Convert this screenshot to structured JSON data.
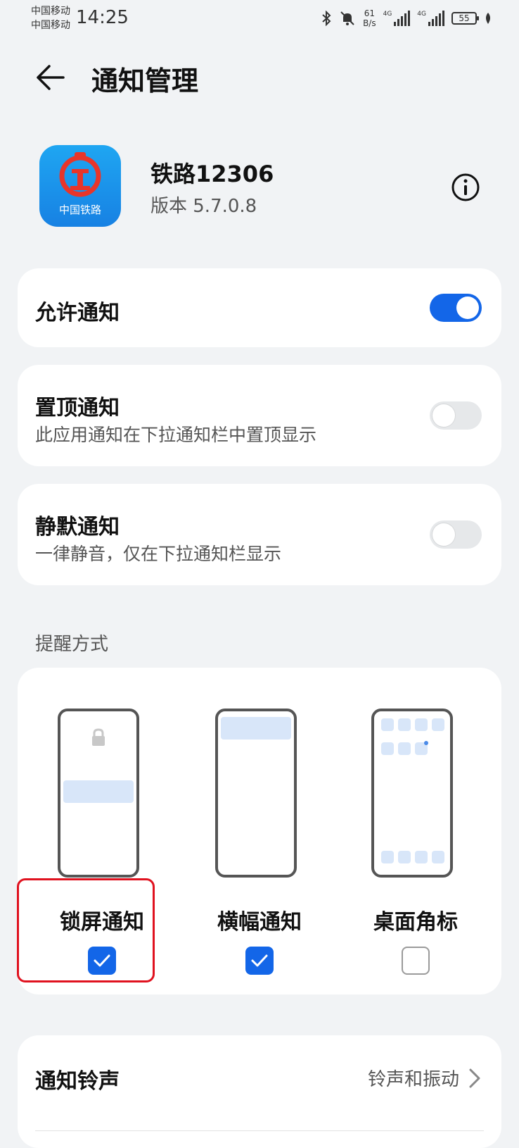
{
  "status_bar": {
    "carrier_1": "中国移动",
    "carrier_2": "中国移动",
    "time": "14:25",
    "net_speed_value": "61",
    "net_speed_unit": "B/s",
    "signal_1_tag": "4G",
    "signal_2_tag": "4G",
    "battery": "55"
  },
  "header": {
    "title": "通知管理"
  },
  "app": {
    "name": "铁路12306",
    "version": "版本 5.7.0.8",
    "icon_label": "中国铁路"
  },
  "settings": {
    "allow": {
      "title": "允许通知",
      "on": true
    },
    "pin": {
      "title": "置顶通知",
      "subtitle": "此应用通知在下拉通知栏中置顶显示",
      "on": false
    },
    "silent": {
      "title": "静默通知",
      "subtitle": "一律静音，仅在下拉通知栏显示",
      "on": false
    }
  },
  "reminder": {
    "section_label": "提醒方式",
    "options": [
      {
        "label": "锁屏通知",
        "checked": true,
        "highlighted": true
      },
      {
        "label": "横幅通知",
        "checked": true,
        "highlighted": false
      },
      {
        "label": "桌面角标",
        "checked": false,
        "highlighted": false
      }
    ]
  },
  "ringtone": {
    "title": "通知铃声",
    "value": "铃声和振动"
  },
  "colors": {
    "accent": "#1366e8",
    "highlight_border": "#e0121f",
    "background": "#f1f3f5",
    "card": "#ffffff"
  }
}
